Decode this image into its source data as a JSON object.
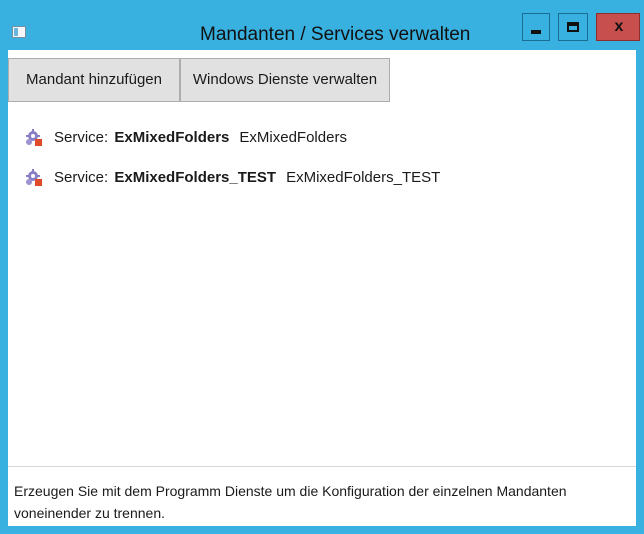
{
  "window": {
    "title": "Mandanten / Services verwalten",
    "close_glyph": "x",
    "accent": "#38b1e0",
    "close_color": "#c7504f"
  },
  "toolbar": {
    "add_label": "Mandant hinzufügen",
    "services_label": "Windows Dienste verwalten"
  },
  "services": [
    {
      "prefix": "Service:",
      "name": "ExMixedFolders",
      "display": "ExMixedFolders",
      "icon": "service-gear-icon"
    },
    {
      "prefix": "Service:",
      "name": "ExMixedFolders_TEST",
      "display": "ExMixedFolders_TEST",
      "icon": "service-gear-icon"
    }
  ],
  "status": {
    "text": "Erzeugen Sie mit dem Programm Dienste um die Konfiguration der einzelnen Mandanten voneinender zu trennen."
  }
}
